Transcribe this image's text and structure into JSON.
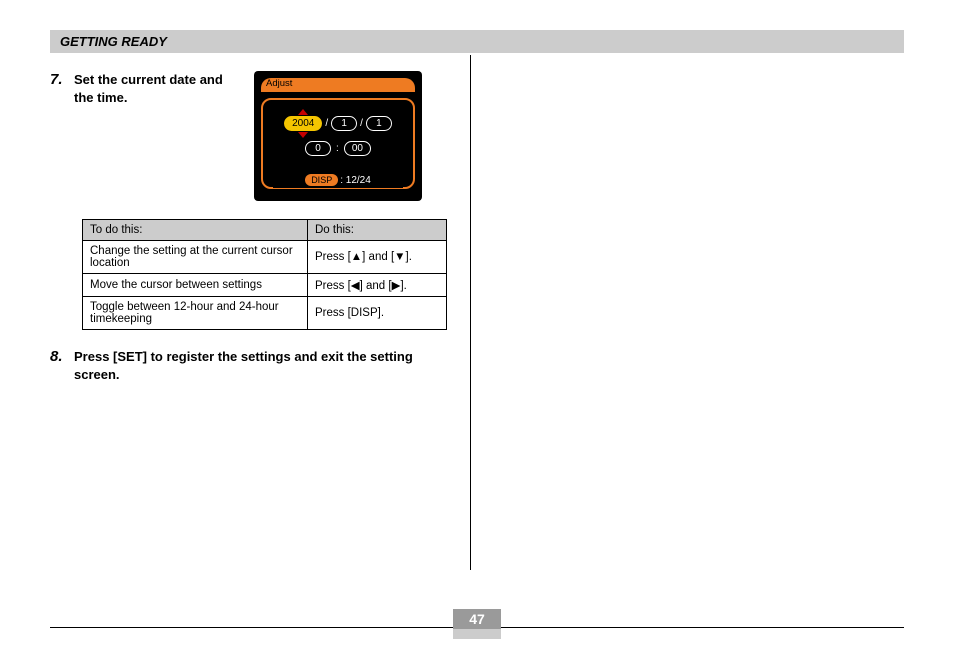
{
  "header": {
    "title": "GETTING READY"
  },
  "step7": {
    "num": "7.",
    "text": "Set the current date and the time."
  },
  "lcd": {
    "title": "Adjust",
    "year": "2004",
    "month": "1",
    "day": "1",
    "hour": "0",
    "minute": "00",
    "disp_label": "DISP",
    "disp_value": ": 12/24"
  },
  "table": {
    "head_left": "To do this:",
    "head_right": "Do this:",
    "rows": [
      {
        "left": "Change the setting at the current cursor location",
        "right": "Press [▲] and [▼]."
      },
      {
        "left": "Move the cursor between settings",
        "right": "Press [◀] and [▶]."
      },
      {
        "left": "Toggle between 12-hour and 24-hour timekeeping",
        "right": "Press [DISP]."
      }
    ]
  },
  "step8": {
    "num": "8.",
    "text": "Press [SET] to register the settings and exit the setting screen."
  },
  "page_number": "47"
}
